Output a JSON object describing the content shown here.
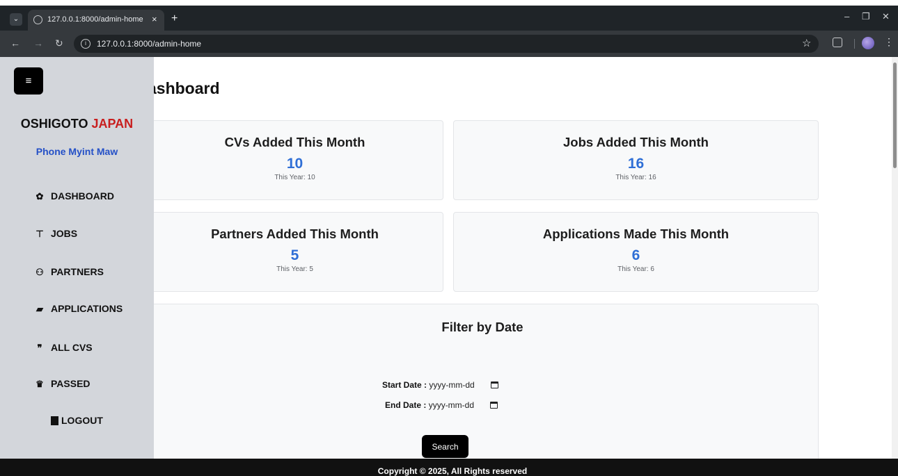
{
  "browser": {
    "tab_title": "127.0.0.1:8000/admin-home",
    "tab_close": "×",
    "new_tab": "+",
    "url": "127.0.0.1:8000/admin-home"
  },
  "sidebar": {
    "menu_icon": "≡",
    "brand_main": "OSHIGOTO",
    "brand_accent": "JAPAN",
    "user_name": "Phone Myint Maw",
    "items": [
      {
        "label": "DASHBOARD",
        "icon": "gear-icon",
        "glyph": "✿"
      },
      {
        "label": "JOBS",
        "icon": "thumbtack-icon",
        "glyph": "⊤"
      },
      {
        "label": "PARTNERS",
        "icon": "handshake-icon",
        "glyph": "⚇"
      },
      {
        "label": "APPLICATIONS",
        "icon": "folder-open-icon",
        "glyph": "▰"
      },
      {
        "label": "ALL CVS",
        "icon": "scroll-icon",
        "glyph": "❞"
      },
      {
        "label": "PASSED",
        "icon": "crown-icon",
        "glyph": "♛"
      }
    ],
    "logout_label": "LOGOUT"
  },
  "main": {
    "heading": "ashboard",
    "stats": [
      {
        "title": "CVs Added This Month",
        "value": "10",
        "sub": "This Year: 10"
      },
      {
        "title": "Jobs Added This Month",
        "value": "16",
        "sub": "This Year: 16"
      },
      {
        "title": "Partners Added This Month",
        "value": "5",
        "sub": "This Year: 5"
      },
      {
        "title": "Applications Made This Month",
        "value": "6",
        "sub": "This Year: 6"
      }
    ],
    "filter": {
      "title": "Filter by Date",
      "start_label": "Start Date :",
      "start_value": "yyyy-mm-dd",
      "end_label": "End Date :",
      "end_value": "yyyy-mm-dd",
      "search_label": "Search"
    }
  },
  "footer": {
    "text": "Copyright © 2025, All Rights reserved"
  },
  "colors": {
    "sidebar_bg": "#d3d6db",
    "accent_red": "#c81e1e",
    "user_blue": "#2450c7",
    "stat_blue": "#2f6fd6",
    "footer_bg": "#111111"
  }
}
